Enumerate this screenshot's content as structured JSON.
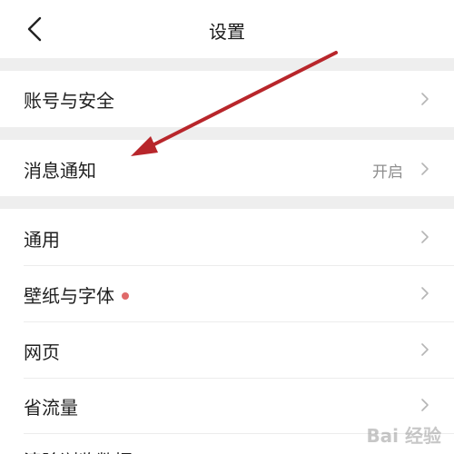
{
  "header": {
    "title": "设置",
    "back_icon": "chevron-left-icon"
  },
  "settings": {
    "account_security": {
      "label": "账号与安全"
    },
    "notifications": {
      "label": "消息通知",
      "value": "开启"
    },
    "general": {
      "label": "通用"
    },
    "wallpaper_font": {
      "label": "壁纸与字体",
      "badge_color": "#e06a6a"
    },
    "web": {
      "label": "网页"
    },
    "data_saver": {
      "label": "省流量"
    },
    "clear_cache": {
      "label": "清除浏览数据"
    }
  },
  "annotation": {
    "arrow_color": "#b8262b"
  },
  "watermark": {
    "text": "Bai 经验"
  }
}
